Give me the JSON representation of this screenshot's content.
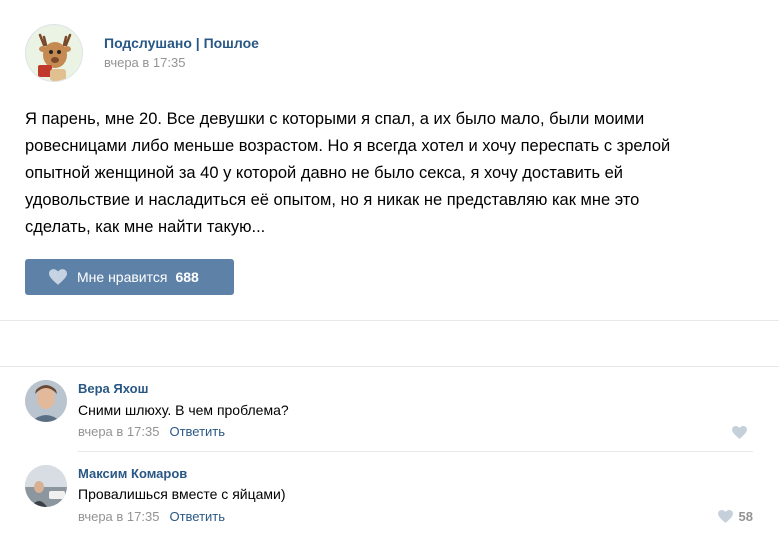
{
  "post": {
    "author": "Подслушано | Пошлое",
    "time": "вчера в 17:35",
    "text": "Я парень, мне 20. Все девушки с которыми я спал, а их было мало, были моими\nровесницами либо меньше возрастом. Но я всегда хотел и хочу переспать с зрелой\nопытной женщиной за 40 у которой давно не было секса, я хочу доставить ей\nудовольствие и насладиться её опытом, но я никак не представляю как мне это\nсделать, как мне найти такую...",
    "like_label": "Мне нравится",
    "like_count": "688",
    "like_icon": "heart-icon"
  },
  "comments": [
    {
      "author": "Вера Яхош",
      "text": "Сними шлюху. В чем проблема?",
      "time": "вчера в 17:35",
      "reply": "Ответить",
      "likes": ""
    },
    {
      "author": "Максим Комаров",
      "text": "Провалишься вместе с яйцами)",
      "time": "вчера в 17:35",
      "reply": "Ответить",
      "likes": "58"
    }
  ],
  "colors": {
    "link": "#2a5885",
    "button": "#5e81a8",
    "muted": "#939393"
  }
}
